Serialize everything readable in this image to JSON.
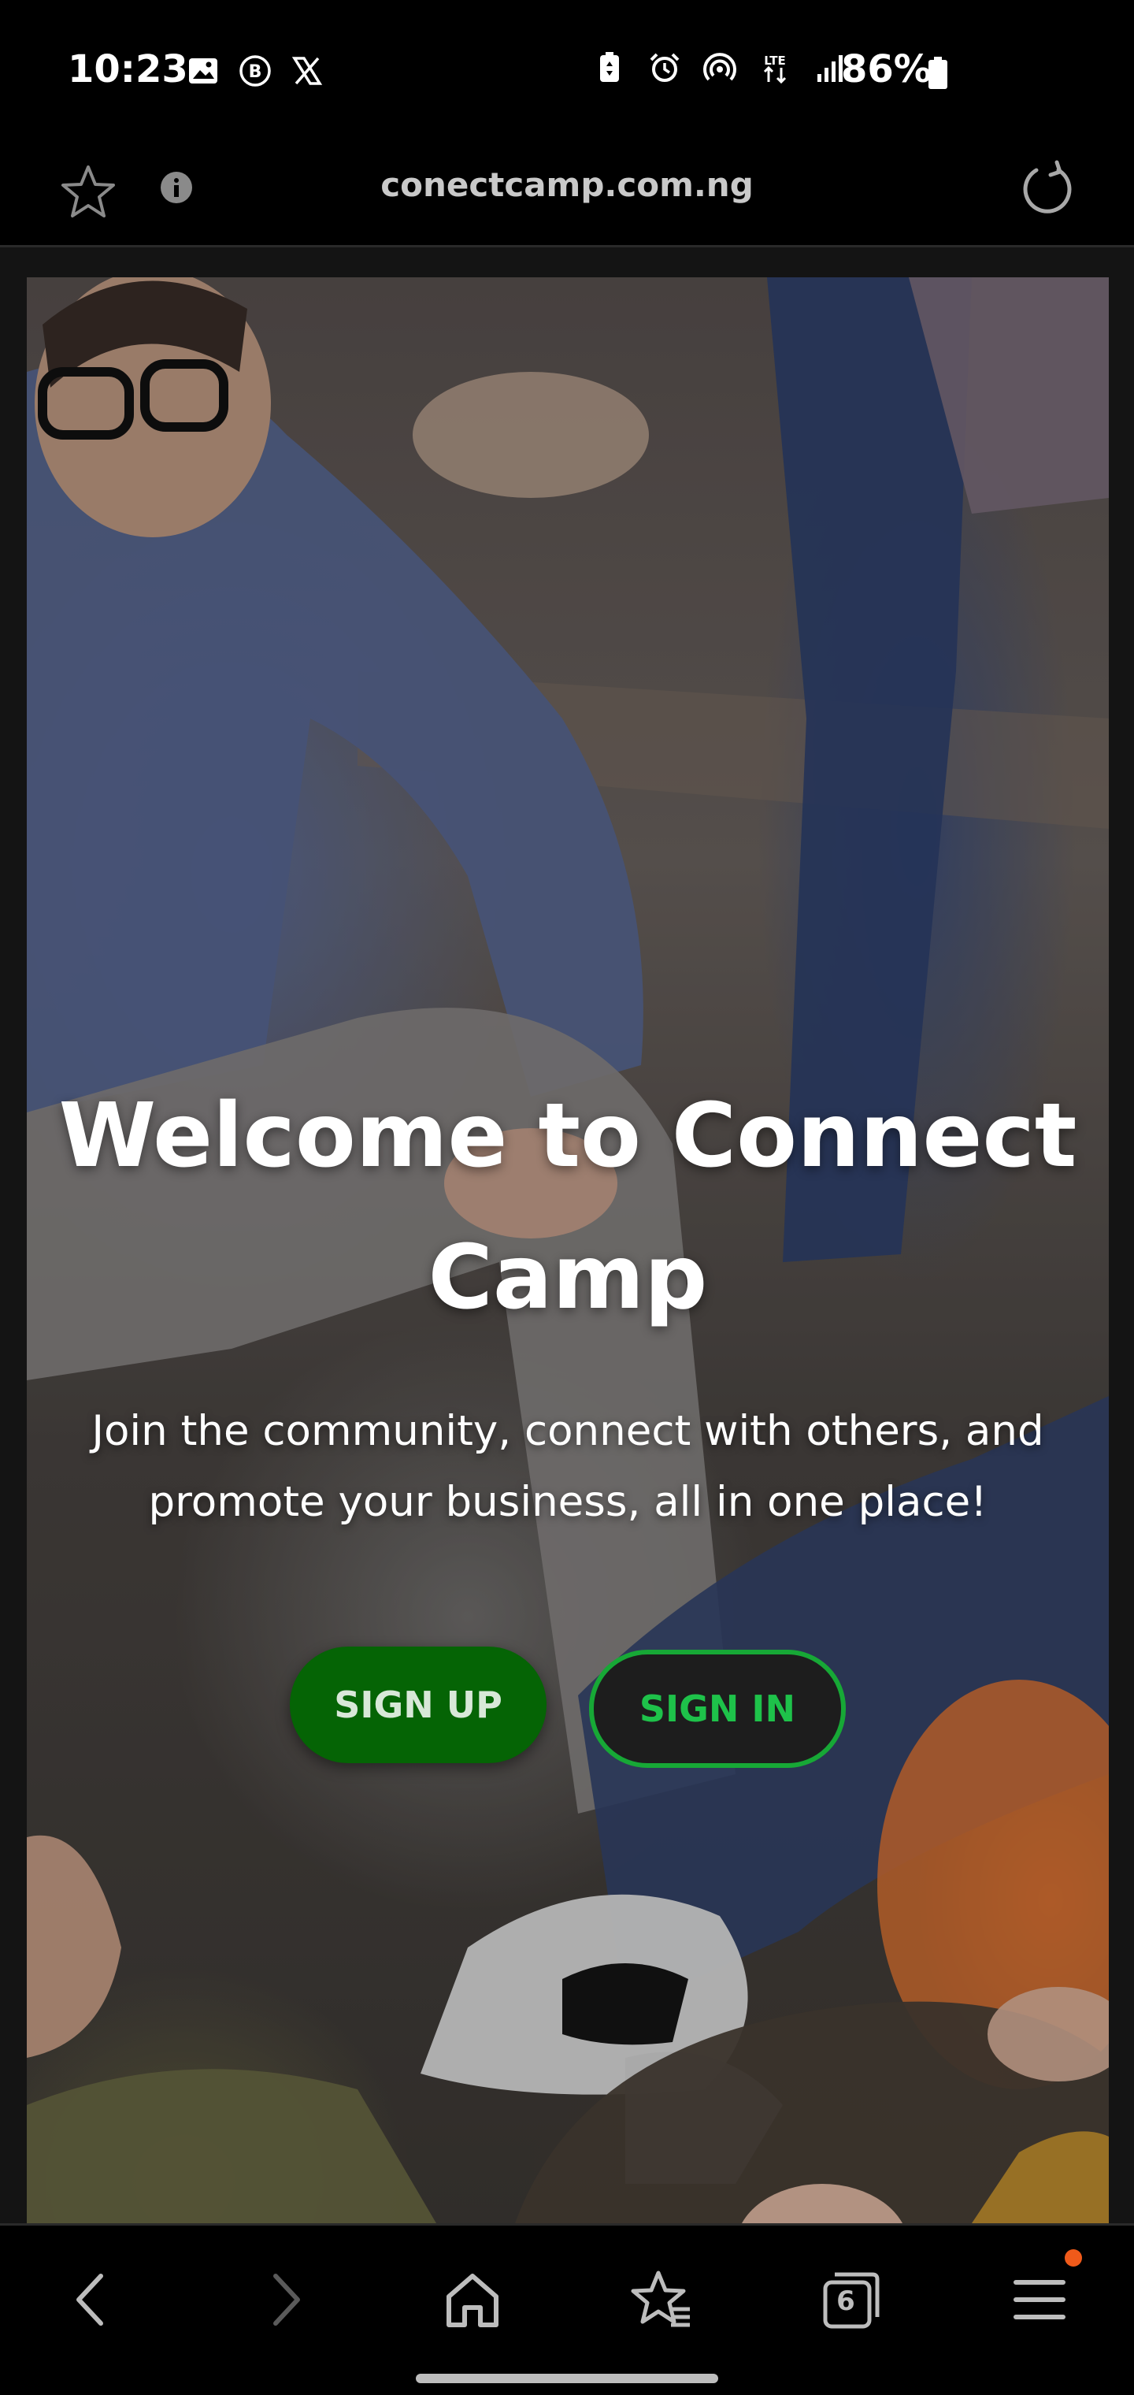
{
  "status_bar": {
    "time": "10:23",
    "left_icons": [
      "image-icon",
      "b-app-icon",
      "x-app-icon"
    ],
    "right_icons": [
      "battery-saver-icon",
      "alarm-icon",
      "hotspot-icon",
      "lte-icon",
      "signal-icon"
    ],
    "battery_percent": "86%",
    "network": "LTE"
  },
  "browser": {
    "url": "conectcamp.com.ng",
    "tab_count": "6"
  },
  "hero": {
    "title": "Welcome to Connect Camp",
    "subtitle": "Join the community, connect with others, and promote your business, all in one place!",
    "signup_label": "SIGN UP",
    "signin_label": "SIGN IN"
  },
  "colors": {
    "signup_bg": "#056405",
    "signin_text": "#1ec24a",
    "signin_border": "#17a836",
    "menu_notification_dot": "#f05a1a"
  },
  "bottom_nav": {
    "items": [
      "back-icon",
      "forward-icon",
      "home-icon",
      "bookmarks-icon",
      "tabs-icon",
      "menu-icon"
    ]
  }
}
